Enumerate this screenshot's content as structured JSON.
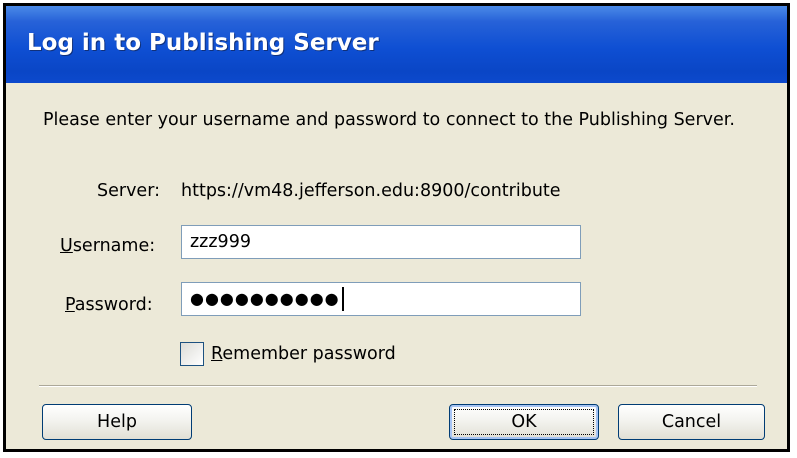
{
  "dialog": {
    "title": "Log in to Publishing Server",
    "prompt": "Please enter your username and password to connect to the Publishing Server.",
    "server_label": "Server:",
    "server_value": "https://vm48.jefferson.edu:8900/contribute",
    "username_label": "Username:",
    "username_value": "zzz999",
    "password_label": "Password:",
    "password_masked": "●●●●●●●●●●",
    "remember_label": "Remember password",
    "remember_checked": false
  },
  "buttons": {
    "help_label": "Help",
    "ok_label": "OK",
    "cancel_label": "Cancel"
  },
  "colors": {
    "titlebar": "#0a46c6",
    "dialog_bg": "#ece9d8",
    "field_border": "#7f9db9",
    "button_border": "#003c74"
  }
}
